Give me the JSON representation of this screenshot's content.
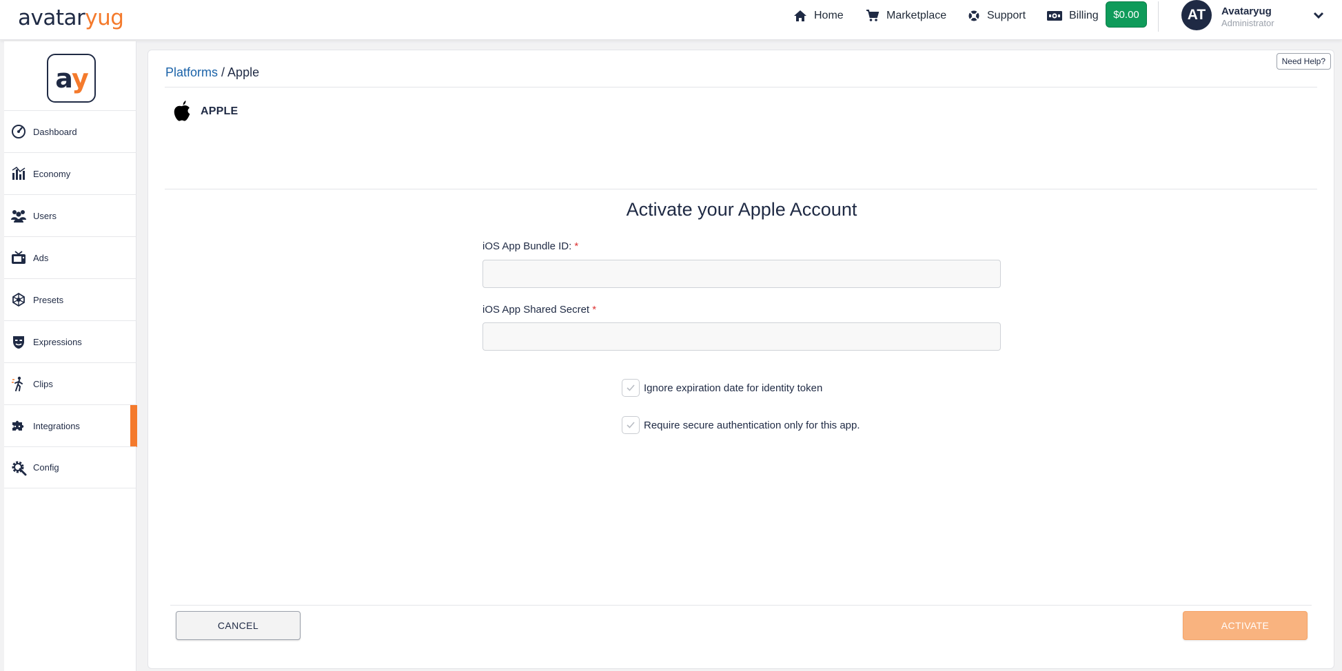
{
  "brand": {
    "part1": "avatar",
    "part2": "yug"
  },
  "nav": {
    "home": "Home",
    "marketplace": "Marketplace",
    "support": "Support",
    "billing": "Billing",
    "balance": "$0.00"
  },
  "user": {
    "initials": "AT",
    "name": "Avataryug",
    "role": "Administrator"
  },
  "sidebar": {
    "logo": {
      "part1": "a",
      "part2": "y"
    },
    "items": [
      {
        "label": "Dashboard",
        "icon": "speedometer-icon"
      },
      {
        "label": "Economy",
        "icon": "bar-chart-icon"
      },
      {
        "label": "Users",
        "icon": "users-icon"
      },
      {
        "label": "Ads",
        "icon": "ads-tv-icon"
      },
      {
        "label": "Presets",
        "icon": "presets-network-icon"
      },
      {
        "label": "Expressions",
        "icon": "mask-icon"
      },
      {
        "label": "Clips",
        "icon": "walking-figure-icon"
      },
      {
        "label": "Integrations",
        "icon": "puzzle-icon"
      },
      {
        "label": "Config",
        "icon": "gear-wrench-icon"
      }
    ],
    "active_index": 7
  },
  "page": {
    "help_label": "Need Help?",
    "breadcrumb": {
      "parent": "Platforms",
      "separator": " / ",
      "current": "Apple"
    },
    "platform_name": "APPLE",
    "form_title": "Activate your Apple Account",
    "fields": {
      "bundle_id": {
        "label": "iOS App Bundle ID:",
        "required_mark": "*",
        "value": ""
      },
      "shared_secret": {
        "label": "iOS App Shared Secret",
        "required_mark": "*",
        "value": ""
      }
    },
    "checkboxes": {
      "ignore_expiration": {
        "label": "Ignore expiration date for identity token",
        "checked": true
      },
      "secure_auth": {
        "label": "Require secure authentication only for this app.",
        "checked": true
      }
    },
    "cancel_label": "CANCEL",
    "activate_label": "ACTIVATE"
  },
  "colors": {
    "accent": "#f47a2c",
    "navy": "#1f2a44",
    "balance_green": "#0f9b5a",
    "link_blue": "#1a62a8",
    "activate_orange": "#f9b37f"
  }
}
